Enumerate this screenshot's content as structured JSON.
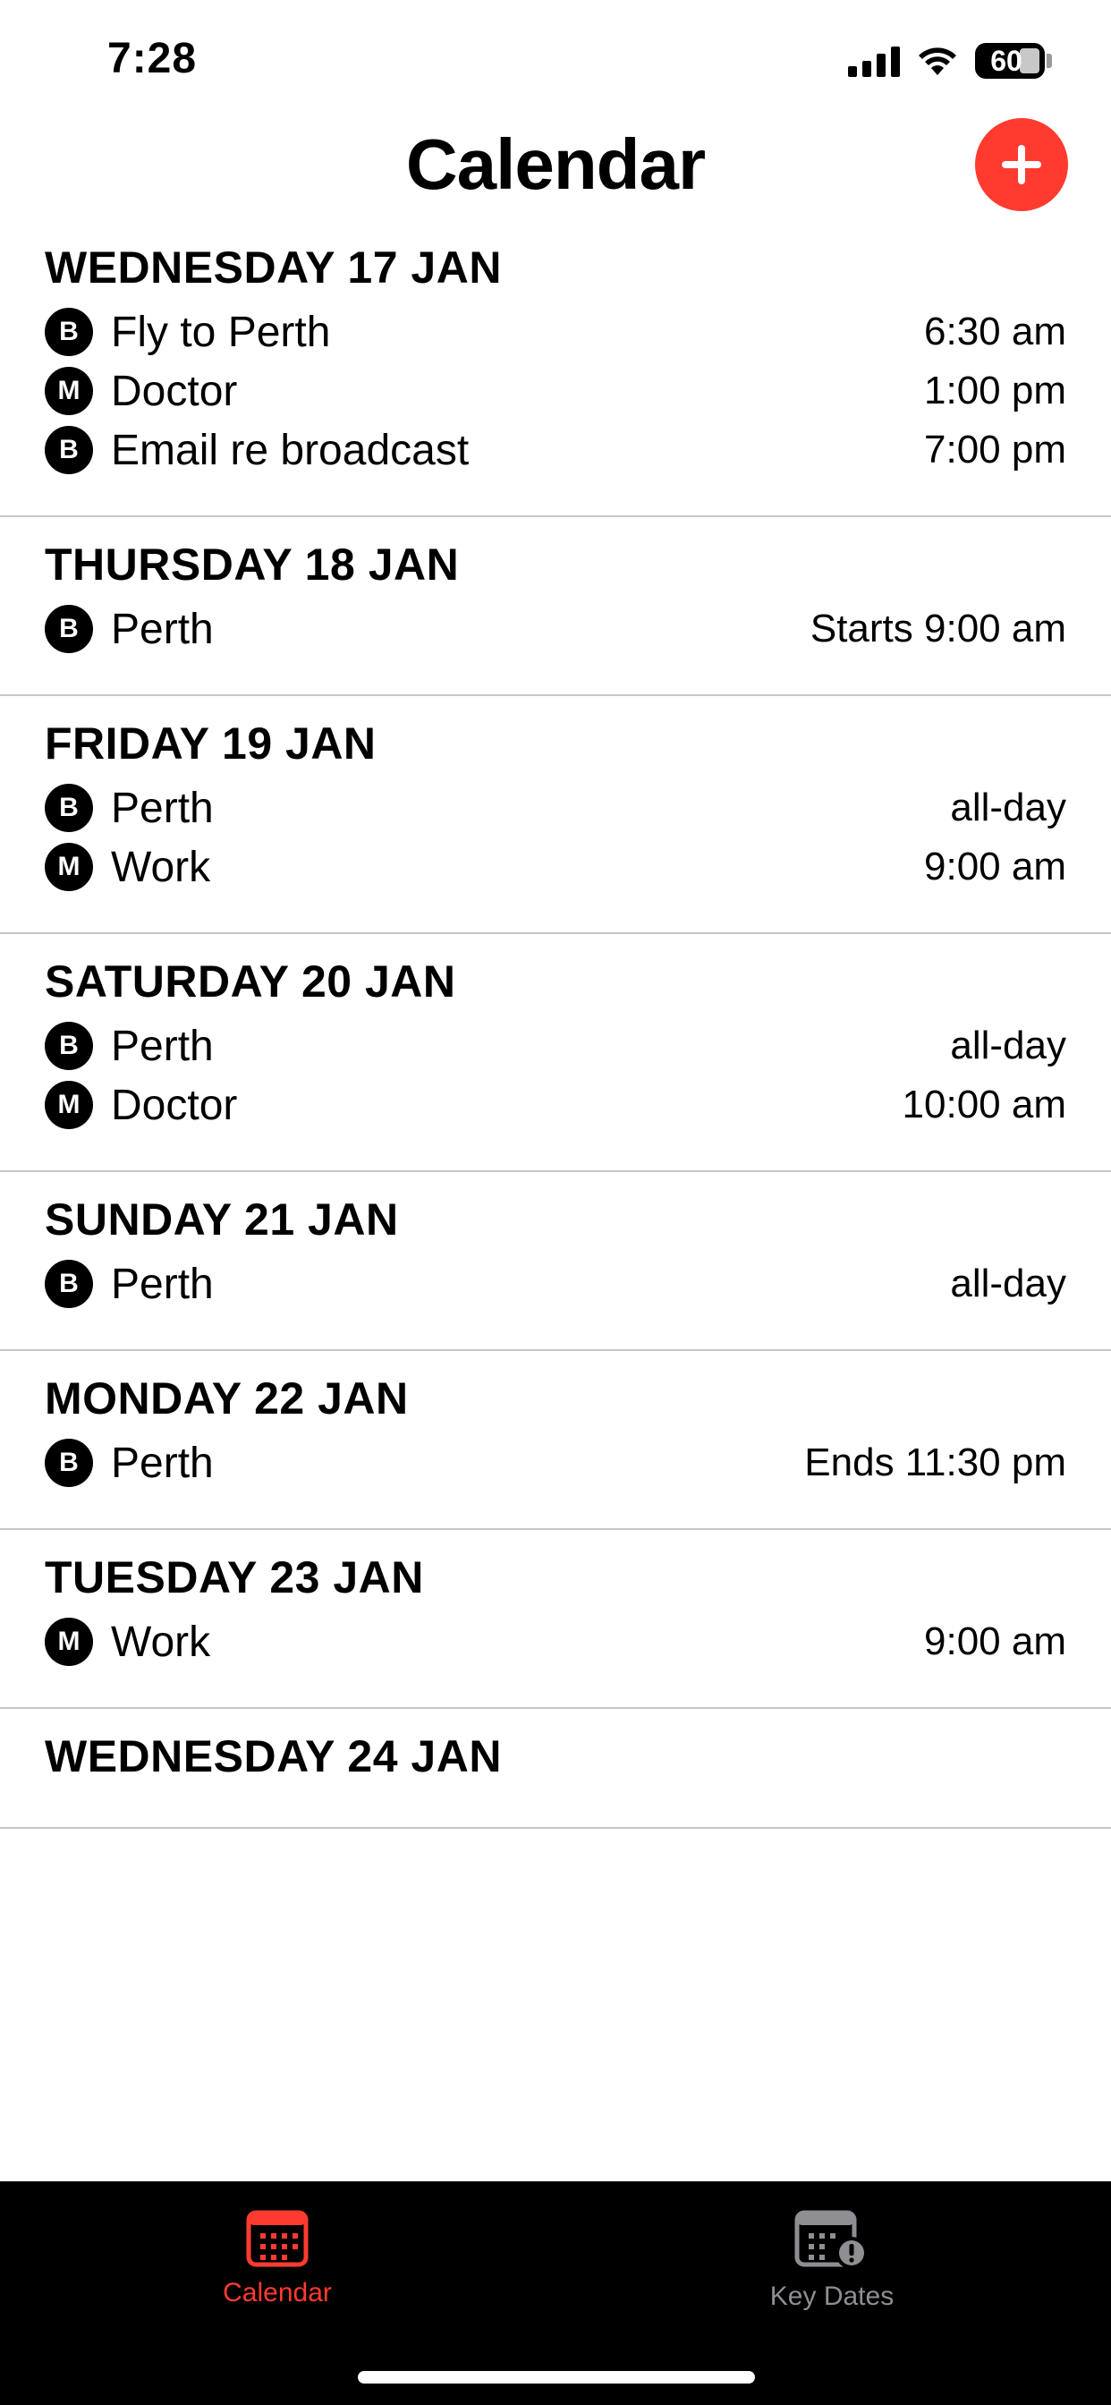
{
  "status_bar": {
    "time": "7:28",
    "battery": "60"
  },
  "header": {
    "title": "Calendar",
    "add_icon": "plus-icon"
  },
  "colors": {
    "accent": "#ff3b30",
    "tab_inactive": "#8e8e93",
    "tab_bar_bg": "#000000",
    "separator": "#c6c6c8"
  },
  "days": [
    {
      "title": "WEDNESDAY 17 JAN",
      "events": [
        {
          "badge": "B",
          "title": "Fly to Perth",
          "time": "6:30 am"
        },
        {
          "badge": "M",
          "title": "Doctor",
          "time": "1:00 pm"
        },
        {
          "badge": "B",
          "title": "Email re broadcast",
          "time": "7:00 pm"
        }
      ]
    },
    {
      "title": "THURSDAY 18 JAN",
      "events": [
        {
          "badge": "B",
          "title": "Perth",
          "time": "Starts 9:00 am"
        }
      ]
    },
    {
      "title": "FRIDAY 19 JAN",
      "events": [
        {
          "badge": "B",
          "title": "Perth",
          "time": "all-day"
        },
        {
          "badge": "M",
          "title": "Work",
          "time": "9:00 am"
        }
      ]
    },
    {
      "title": "SATURDAY 20 JAN",
      "events": [
        {
          "badge": "B",
          "title": "Perth",
          "time": "all-day"
        },
        {
          "badge": "M",
          "title": "Doctor",
          "time": "10:00 am"
        }
      ]
    },
    {
      "title": "SUNDAY 21 JAN",
      "events": [
        {
          "badge": "B",
          "title": "Perth",
          "time": "all-day"
        }
      ]
    },
    {
      "title": "MONDAY 22 JAN",
      "events": [
        {
          "badge": "B",
          "title": "Perth",
          "time": "Ends 11:30 pm"
        }
      ]
    },
    {
      "title": "TUESDAY 23 JAN",
      "events": [
        {
          "badge": "M",
          "title": "Work",
          "time": "9:00 am"
        }
      ]
    },
    {
      "title": "WEDNESDAY 24 JAN",
      "events": []
    }
  ],
  "tabs": [
    {
      "label": "Calendar",
      "icon": "calendar-icon",
      "selected": true
    },
    {
      "label": "Key Dates",
      "icon": "calendar-alert-icon",
      "selected": false
    }
  ]
}
